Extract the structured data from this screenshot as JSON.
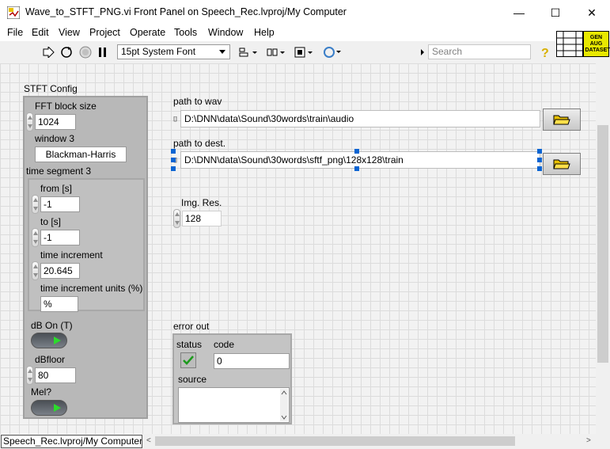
{
  "window": {
    "title": "Wave_to_STFT_PNG.vi Front Panel on Speech_Rec.lvproj/My Computer",
    "minimize": "—",
    "maximize": "☐",
    "close": "✕"
  },
  "menu": [
    "File",
    "Edit",
    "View",
    "Project",
    "Operate",
    "Tools",
    "Window",
    "Help"
  ],
  "toolbar": {
    "font": "15pt System Font",
    "search_placeholder": "Search",
    "connector_label": "GEN AUG DATASET"
  },
  "stft_config": {
    "label": "STFT Config",
    "fft_block_size_label": "FFT block size",
    "fft_block_size": "1024",
    "window_label": "window 3",
    "window_value": "Blackman-Harris",
    "time_segment_label": "time segment 3",
    "from_label": "from [s]",
    "from_value": "-1",
    "to_label": "to [s]",
    "to_value": "-1",
    "time_inc_label": "time increment",
    "time_inc_value": "20.645",
    "time_inc_units_label": "time increment units (%)",
    "time_inc_units_value": "%",
    "db_on_label": "dB On (T)",
    "dbfloor_label": "dBfloor",
    "dbfloor_value": "80",
    "mel_label": "Mel?"
  },
  "paths": {
    "wav_label": "path to wav",
    "wav_value": "D:\\DNN\\data\\Sound\\30words\\train\\audio",
    "dest_label": "path to dest.",
    "dest_value": "D:\\DNN\\data\\Sound\\30words\\sftf_png\\128x128\\train"
  },
  "img_res": {
    "label": "Img. Res.",
    "value": "128"
  },
  "error_out": {
    "label": "error out",
    "status_label": "status",
    "code_label": "code",
    "code_value": "0",
    "source_label": "source"
  },
  "statusbar": {
    "project": "Speech_Rec.lvproj/My Computer"
  },
  "colors": {
    "led_on": "#2bdc2b",
    "selection": "#0a64d2",
    "cluster_bg": "#b8b8b8"
  }
}
